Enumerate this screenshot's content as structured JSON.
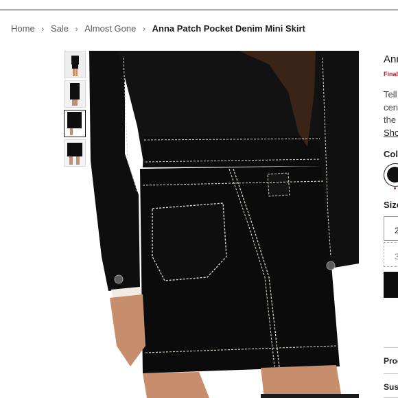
{
  "breadcrumb": {
    "items": [
      "Home",
      "Sale",
      "Almost Gone",
      "Anna Patch Pocket Denim Mini Skirt"
    ]
  },
  "thumbnails": {
    "count": 4,
    "active_index": 2
  },
  "product": {
    "title": "Ann",
    "final_sale_badge": "Final",
    "description_lines": [
      "Tell",
      "cen",
      "the"
    ],
    "show_more": "Sho",
    "color_label": "Col",
    "selected_color": "#111111",
    "size_label": "Size",
    "sizes": [
      "2",
      "3"
    ],
    "accordions": [
      "Prod",
      "Sus"
    ]
  },
  "colors": {
    "final_sale": "#b2202a",
    "garment": "#0d0d0d",
    "stitching": "#d9d4c8",
    "skin": "#c68e6c"
  },
  "icons": {
    "wishlist": "heart-outline-icon",
    "breadcrumb_separator": "chevron-right-icon"
  }
}
